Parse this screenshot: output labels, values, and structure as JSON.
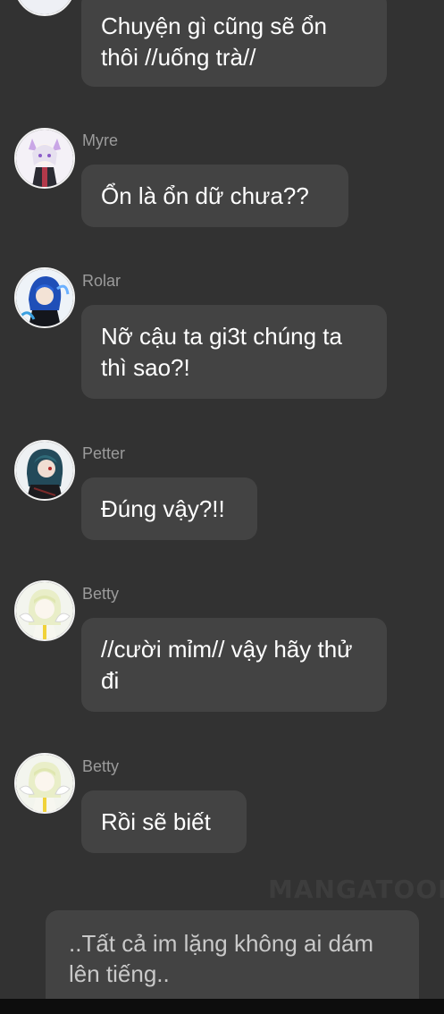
{
  "messages": [
    {
      "sender": "",
      "text": "Chuyện gì cũng sẽ ổn thôi //uống trà//",
      "avatar_icon": "character-avatar-icon"
    },
    {
      "sender": "Myre",
      "text": "Ổn là ổn dữ chưa??",
      "avatar_icon": "myre-avatar-icon"
    },
    {
      "sender": "Rolar",
      "text": "Nỡ cậu ta gi3t chúng ta thì sao?!",
      "avatar_icon": "rolar-avatar-icon"
    },
    {
      "sender": "Petter",
      "text": "Đúng vậy?!!",
      "avatar_icon": "petter-avatar-icon"
    },
    {
      "sender": "Betty",
      "text": "//cười mỉm// vậy hãy thử đi",
      "avatar_icon": "betty-avatar-icon"
    },
    {
      "sender": "Betty",
      "text": "Rồi sẽ biết",
      "avatar_icon": "betty-avatar-icon"
    }
  ],
  "narration": "..Tất cả im lặng không ai dám lên tiếng..",
  "watermark": "MANGATOON",
  "colors": {
    "background": "#323232",
    "bubble": "#434343",
    "sender_name": "#9b9b9b",
    "message_text": "#ffffff",
    "narration_text": "#c9c9c9"
  }
}
